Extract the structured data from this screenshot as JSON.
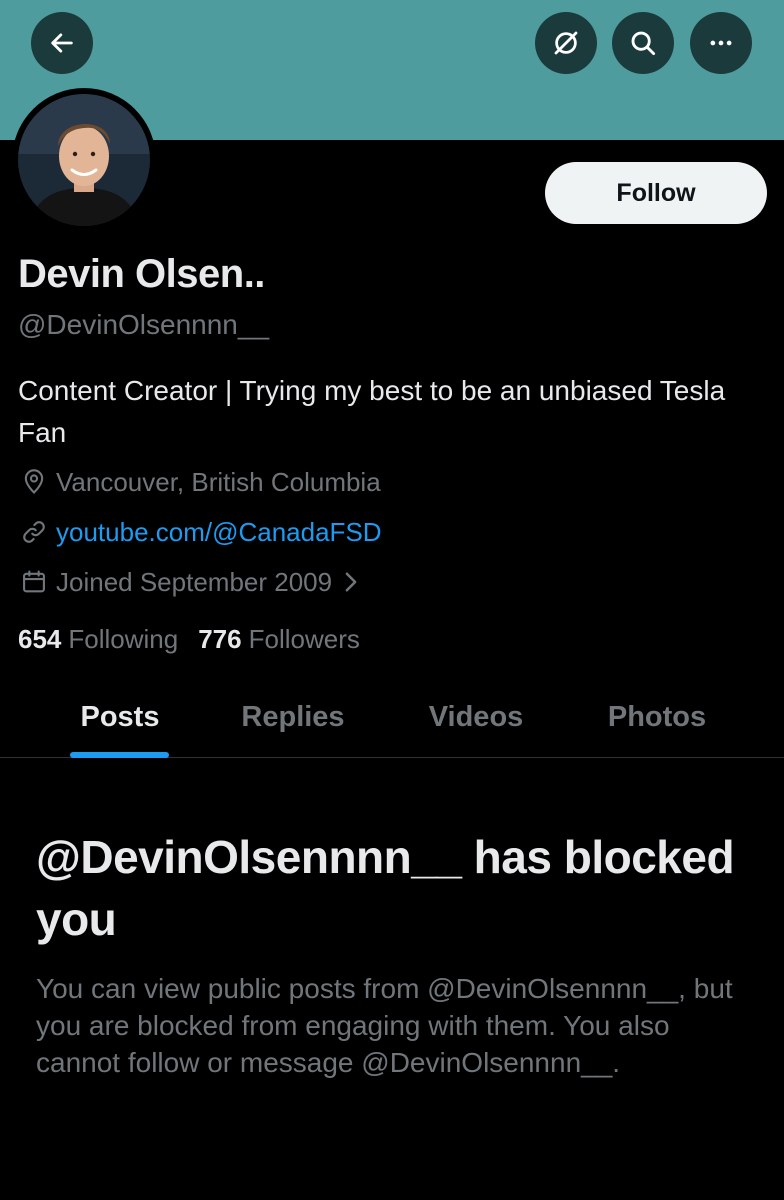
{
  "colors": {
    "banner": "#4e9c9e",
    "background": "#000000",
    "accent": "#1d9bf0",
    "primary_text": "#e7e9ea",
    "secondary_text": "#71767b",
    "follow_button_bg": "#eff3f4"
  },
  "header": {
    "icons": [
      "back-arrow-icon",
      "no-sign-icon",
      "search-icon",
      "more-icon"
    ]
  },
  "profile": {
    "follow_label": "Follow",
    "name": "Devin Olsen..",
    "handle": "@DevinOlsennnn__",
    "bio": "Content Creator | Trying my best to be an unbiased Tesla Fan",
    "location": "Vancouver, British Columbia",
    "link": "youtube.com/@CanadaFSD",
    "joined": "Joined September 2009",
    "following_count": "654",
    "following_label": "Following",
    "followers_count": "776",
    "followers_label": "Followers"
  },
  "tabs": [
    {
      "label": "Posts",
      "active": true
    },
    {
      "label": "Replies",
      "active": false
    },
    {
      "label": "Videos",
      "active": false
    },
    {
      "label": "Photos",
      "active": false
    }
  ],
  "blocked": {
    "title": "@DevinOlsennnn__ has blocked you",
    "body": "You can view public posts from @DevinOlsennnn__, but you are blocked from engaging with them. You also cannot follow or message @DevinOlsennnn__."
  }
}
